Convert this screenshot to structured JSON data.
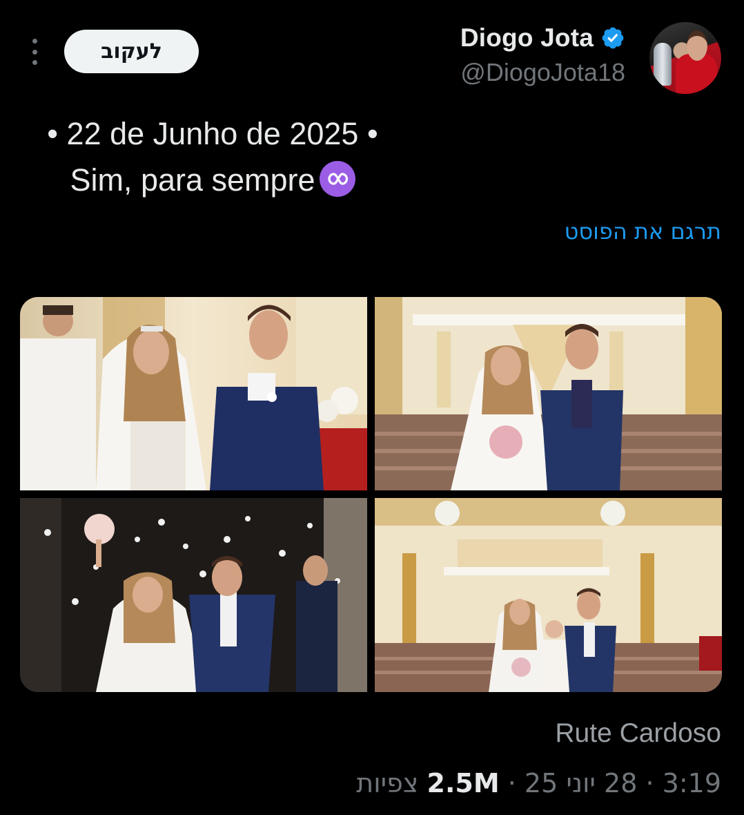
{
  "author": {
    "display_name": "Diogo Jota",
    "handle": "@DiogoJota18",
    "verified": true,
    "avatar_icon": "profile-photo"
  },
  "actions": {
    "follow_label": "לעקוב",
    "more_icon": "more-vertical-icon"
  },
  "post": {
    "line1": "• 22 de Junho de 2025 •",
    "line2": "Sim, para sempre",
    "emoji": "infinity-icon",
    "translate_label": "תרגם את הפוסט"
  },
  "media": {
    "photo_count": 4,
    "credit": "Rute Cardoso"
  },
  "meta": {
    "time": "3:19",
    "date": "28 יוני 25",
    "separator": "·",
    "views_count": "2.5M",
    "views_label": "צפיות"
  },
  "colors": {
    "background": "#000000",
    "text": "#e7e9ea",
    "muted": "#71767b",
    "link": "#1d9bf0",
    "verified": "#1d9bf0",
    "infinity": "#9b5de5"
  }
}
